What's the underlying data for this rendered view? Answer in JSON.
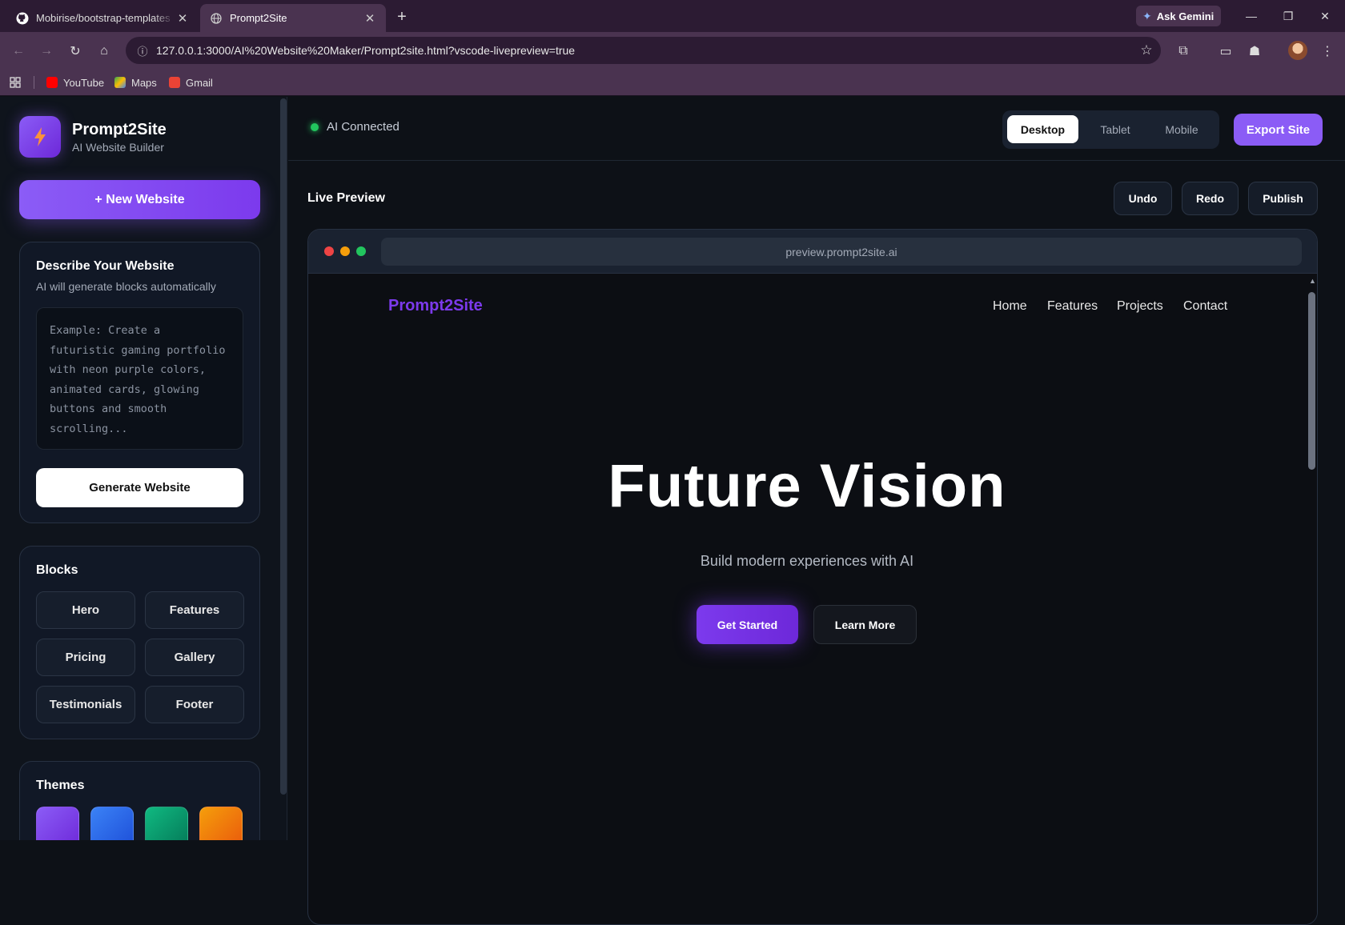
{
  "browser": {
    "tabs": [
      {
        "title": "Mobirise/bootstrap-templates",
        "icon": "github-icon"
      },
      {
        "title": "Prompt2Site",
        "icon": "globe-icon"
      }
    ],
    "ask_gemini": "Ask Gemini",
    "url": "127.0.0.1:3000/AI%20Website%20Maker/Prompt2site.html?vscode-livepreview=true",
    "bookmarks": [
      {
        "label": "YouTube",
        "color": "#ff0000"
      },
      {
        "label": "Maps",
        "color": "#34a853"
      },
      {
        "label": "Gmail",
        "color": "#ea4335"
      }
    ]
  },
  "sidebar": {
    "brand_name": "Prompt2Site",
    "brand_sub": "AI Website Builder",
    "new_website": "+  New Website",
    "describe": {
      "title": "Describe Your Website",
      "subtitle": "AI will generate blocks automatically",
      "placeholder": "Example: Create a futuristic gaming portfolio with neon purple colors, animated cards, glowing buttons and smooth scrolling...",
      "generate": "Generate Website"
    },
    "blocks": {
      "title": "Blocks",
      "items": [
        "Hero",
        "Features",
        "Pricing",
        "Gallery",
        "Testimonials",
        "Footer"
      ]
    },
    "themes": {
      "title": "Themes",
      "colors": [
        "#8b5cf6",
        "#3b82f6",
        "#10b981",
        "#f59e0b"
      ]
    }
  },
  "topbar": {
    "status": "AI Connected",
    "devices": [
      "Desktop",
      "Tablet",
      "Mobile"
    ],
    "active_device": "Desktop",
    "export": "Export Site"
  },
  "preview": {
    "title": "Live Preview",
    "actions": [
      "Undo",
      "Redo",
      "Publish"
    ],
    "url": "preview.prompt2site.ai",
    "site": {
      "logo": "Prompt2Site",
      "nav": [
        "Home",
        "Features",
        "Projects",
        "Contact"
      ],
      "hero_title": "Future Vision",
      "hero_subtitle": "Build modern experiences with AI",
      "cta_primary": "Get Started",
      "cta_secondary": "Learn More"
    }
  }
}
